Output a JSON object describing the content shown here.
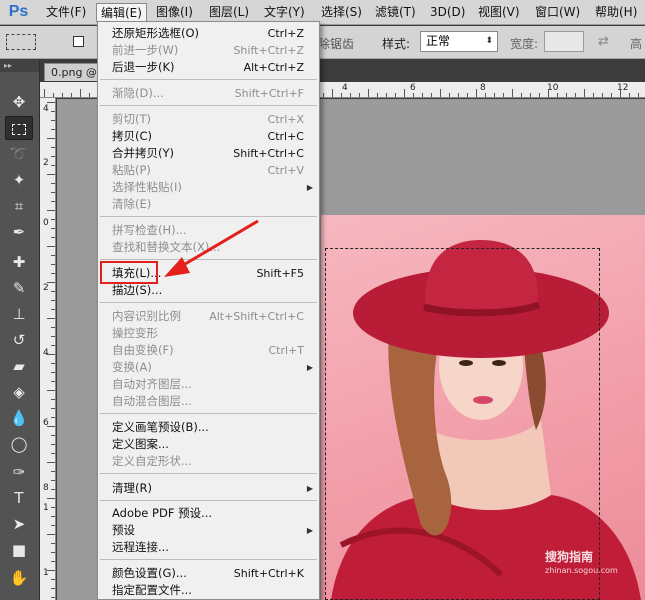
{
  "app": {
    "logo": "Ps"
  },
  "menubar": {
    "items": [
      "文件(F)",
      "编辑(E)",
      "图像(I)",
      "图层(L)",
      "文字(Y)",
      "选择(S)",
      "滤镜(T)",
      "3D(D)",
      "视图(V)",
      "窗口(W)",
      "帮助(H)"
    ],
    "active_index": 1
  },
  "options": {
    "antialias_label": "除锯齿",
    "style_label": "样式:",
    "style_value": "正常",
    "width_label": "宽度:",
    "height_label": "高"
  },
  "document": {
    "tab_label": "0.png @"
  },
  "ruler": {
    "top_numbers": [
      "2",
      "0",
      "2",
      "4",
      "6",
      "8",
      "10",
      "12"
    ],
    "left_numbers": [
      "4",
      "2",
      "0",
      "2",
      "4",
      "6",
      "8",
      "1",
      "1"
    ]
  },
  "edit_menu": {
    "items": [
      {
        "label": "还原矩形选框(O)",
        "shortcut": "Ctrl+Z",
        "disabled": false
      },
      {
        "label": "前进一步(W)",
        "shortcut": "Shift+Ctrl+Z",
        "disabled": true
      },
      {
        "label": "后退一步(K)",
        "shortcut": "Alt+Ctrl+Z",
        "disabled": false
      },
      {
        "label": "渐隐(D)...",
        "shortcut": "Shift+Ctrl+F",
        "disabled": true
      },
      {
        "label": "剪切(T)",
        "shortcut": "Ctrl+X",
        "disabled": true
      },
      {
        "label": "拷贝(C)",
        "shortcut": "Ctrl+C",
        "disabled": false
      },
      {
        "label": "合并拷贝(Y)",
        "shortcut": "Shift+Ctrl+C",
        "disabled": false
      },
      {
        "label": "粘贴(P)",
        "shortcut": "Ctrl+V",
        "disabled": true
      },
      {
        "label": "选择性粘贴(I)",
        "shortcut": "",
        "disabled": true
      },
      {
        "label": "清除(E)",
        "shortcut": "",
        "disabled": true
      },
      {
        "label": "拼写检查(H)...",
        "shortcut": "",
        "disabled": true
      },
      {
        "label": "查找和替换文本(X)...",
        "shortcut": "",
        "disabled": true
      },
      {
        "label": "填充(L)...",
        "shortcut": "Shift+F5",
        "disabled": false
      },
      {
        "label": "描边(S)...",
        "shortcut": "",
        "disabled": false
      },
      {
        "label": "内容识别比例",
        "shortcut": "Alt+Shift+Ctrl+C",
        "disabled": true
      },
      {
        "label": "操控变形",
        "shortcut": "",
        "disabled": true
      },
      {
        "label": "自由变换(F)",
        "shortcut": "Ctrl+T",
        "disabled": true
      },
      {
        "label": "变换(A)",
        "shortcut": "",
        "disabled": true
      },
      {
        "label": "自动对齐图层...",
        "shortcut": "",
        "disabled": true
      },
      {
        "label": "自动混合图层...",
        "shortcut": "",
        "disabled": true
      },
      {
        "label": "定义画笔预设(B)...",
        "shortcut": "",
        "disabled": false
      },
      {
        "label": "定义图案...",
        "shortcut": "",
        "disabled": false
      },
      {
        "label": "定义自定形状...",
        "shortcut": "",
        "disabled": true
      },
      {
        "label": "清理(R)",
        "shortcut": "",
        "disabled": false
      },
      {
        "label": "Adobe PDF 预设...",
        "shortcut": "",
        "disabled": false
      },
      {
        "label": "预设",
        "shortcut": "",
        "disabled": false
      },
      {
        "label": "远程连接...",
        "shortcut": "",
        "disabled": false
      },
      {
        "label": "颜色设置(G)...",
        "shortcut": "Shift+Ctrl+K",
        "disabled": false
      },
      {
        "label": "指定配置文件...",
        "shortcut": "",
        "disabled": false
      }
    ]
  },
  "watermark": {
    "text": "搜狗指南",
    "sub": "zhinan.sogou.com"
  },
  "colors": {
    "highlight": "#e3201b",
    "arrow": "#e3201b",
    "photo_bg": "#f3a3ae",
    "hat": "#b81c36"
  },
  "icons": [
    "move-icon",
    "marquee-icon",
    "lasso-icon",
    "magic-wand-icon",
    "crop-icon",
    "eyedropper-icon",
    "healing-brush-icon",
    "brush-icon",
    "clone-stamp-icon",
    "history-brush-icon",
    "eraser-icon",
    "paint-bucket-icon",
    "blur-icon",
    "dodge-icon",
    "pen-icon",
    "type-icon",
    "path-selection-icon",
    "shape-icon",
    "hand-icon"
  ]
}
